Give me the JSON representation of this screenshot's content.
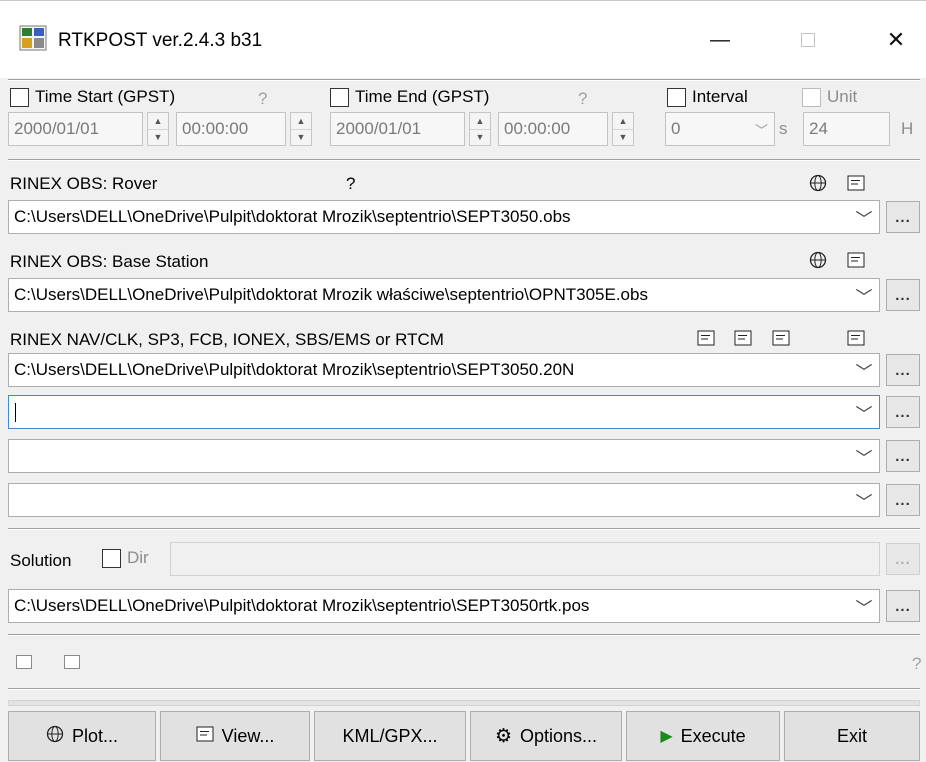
{
  "window": {
    "title": "RTKPOST ver.2.4.3 b31",
    "minimize_glyph": "—",
    "maximize_glyph": "☐",
    "close_glyph": "✕"
  },
  "time": {
    "start_label": "Time Start (GPST)",
    "start_help": "?",
    "start_date": "2000/01/01",
    "start_time": "00:00:00",
    "end_label": "Time End (GPST)",
    "end_help": "?",
    "end_date": "2000/01/01",
    "end_time": "00:00:00",
    "interval_label": "Interval",
    "interval_value": "0",
    "interval_unit": "s",
    "unit_label": "Unit",
    "unit_value": "24",
    "unit_suffix": "H"
  },
  "inputs": {
    "rover_label": "RINEX OBS: Rover",
    "rover_help": "?",
    "rover_path": "C:\\Users\\DELL\\OneDrive\\Pulpit\\doktorat Mrozik\\septentrio\\SEPT3050.obs",
    "base_label": "RINEX OBS: Base Station",
    "base_path": "C:\\Users\\DELL\\OneDrive\\Pulpit\\doktorat Mrozik właściwe\\septentrio\\OPNT305E.obs",
    "nav_label": "RINEX NAV/CLK, SP3, FCB, IONEX, SBS/EMS  or RTCM",
    "nav_path": "C:\\Users\\DELL\\OneDrive\\Pulpit\\doktorat Mrozik\\septentrio\\SEPT3050.20N",
    "extra_paths": [
      "",
      "",
      ""
    ],
    "browse_label": "..."
  },
  "output": {
    "solution_label": "Solution",
    "dir_label": "Dir",
    "dir_value": "",
    "solution_path": "C:\\Users\\DELL\\OneDrive\\Pulpit\\doktorat Mrozik\\septentrio\\SEPT3050rtk.pos"
  },
  "status": {
    "help": "?"
  },
  "buttons": {
    "plot": "Plot...",
    "view": "View...",
    "kml": "KML/GPX...",
    "options": "Options...",
    "execute": "Execute",
    "exit": "Exit"
  },
  "colors": {
    "execute_arrow": "#1a8a1a",
    "focus_border": "#3c8cd8"
  },
  "icons": [
    "app-icon",
    "globe-icon",
    "document-icon",
    "gear-icon",
    "play-icon",
    "chevron-down-icon"
  ]
}
